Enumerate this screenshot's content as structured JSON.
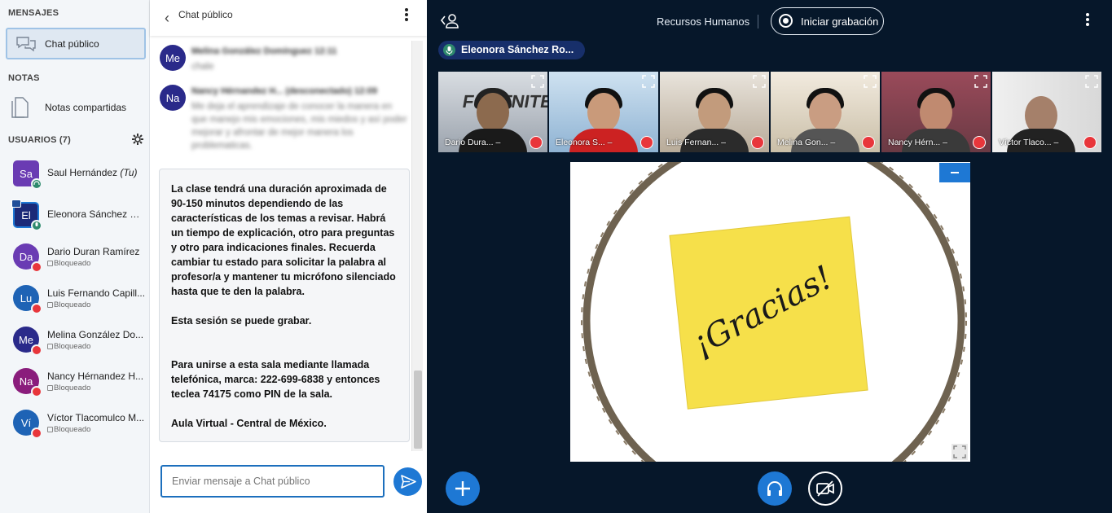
{
  "sidebar": {
    "messages_title": "MENSAJES",
    "public_chat": "Chat público",
    "notes_title": "NOTAS",
    "shared_notes": "Notas compartidas",
    "users_title": "USUARIOS (7)",
    "users": [
      {
        "initials": "Sa",
        "name": "Saul Hernández",
        "you": "(Tu)",
        "status": "",
        "color": "#6a3bb3"
      },
      {
        "initials": "El",
        "name": "Eleonora Sánchez Ro...",
        "status": "",
        "color": "#1c2a78"
      },
      {
        "initials": "Da",
        "name": "Dario Duran Ramírez",
        "status": "Bloqueado",
        "color": "#6a3bb3"
      },
      {
        "initials": "Lu",
        "name": "Luis Fernando Capill...",
        "status": "Bloqueado",
        "color": "#1e63b5"
      },
      {
        "initials": "Me",
        "name": "Melina González Do...",
        "status": "Bloqueado",
        "color": "#2a2a8a"
      },
      {
        "initials": "Na",
        "name": "Nancy Hérnandez H...",
        "status": "Bloqueado",
        "color": "#8a1d7c"
      },
      {
        "initials": "Ví",
        "name": "Víctor Tlacomulco M...",
        "status": "Bloqueado",
        "color": "#1e63b5"
      }
    ]
  },
  "chat": {
    "title": "Chat público",
    "messages": [
      {
        "initials": "Me",
        "author": "Melina González Domínguez  12:11",
        "text": "chale"
      },
      {
        "initials": "Na",
        "author": "Nancy Hérnandez H...  (desconectado)  12:09",
        "text": "Me deja el aprendizaje de conocer la manera en que manejo mis emociones, mis miedos y así poder mejorar y afrontar de mejor manera los problematicas."
      }
    ],
    "welcome": [
      "La clase tendrá una duración aproximada de 90-150 minutos dependiendo de las características de los temas a revisar. Habrá un tiempo de explicación, otro para preguntas y otro para indicaciones finales. Recuerda cambiar tu estado para solicitar la palabra al profesor/a y mantener tu micrófono silenciado hasta que te den la palabra.",
      "Esta sesión se puede grabar.",
      "Para unirse a esta sala mediante llamada telefónica, marca: 222-699-6838 y entonces teclea 74175 como PIN de la sala.",
      "Aula Virtual - Central de México."
    ],
    "input_placeholder": "Enviar mensaje a Chat público"
  },
  "main": {
    "room_name": "Recursos Humanos",
    "record_label": "Iniciar grabación",
    "talker": "Eleonora Sánchez Ro...",
    "tiles": [
      {
        "name": "Dario Dura...",
        "status": "–"
      },
      {
        "name": "Eleonora S...",
        "status": "–"
      },
      {
        "name": "Luis Fernan...",
        "status": "–"
      },
      {
        "name": "Melina Gon...",
        "status": "–"
      },
      {
        "name": "Nancy Hérn...",
        "status": "–"
      },
      {
        "name": "Víctor Tlaco...",
        "status": "–"
      }
    ],
    "slide_text": "¡Gracias!"
  }
}
